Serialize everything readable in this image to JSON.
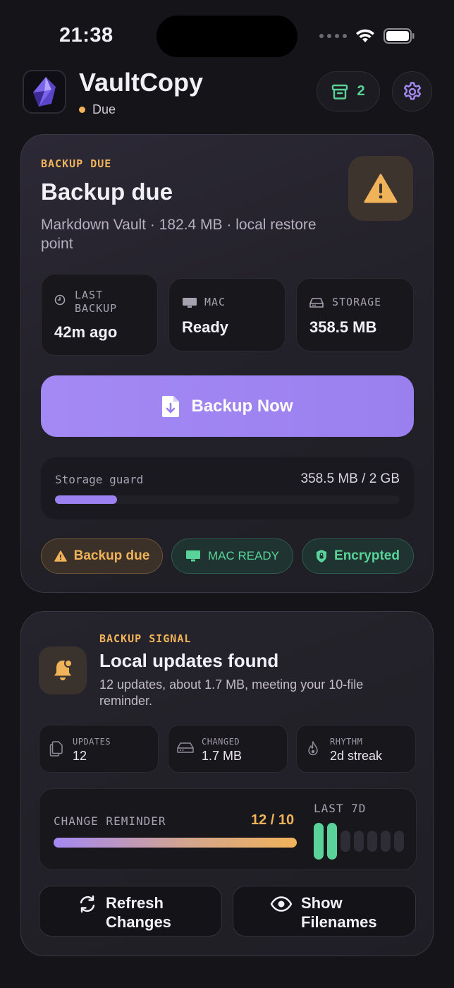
{
  "status_bar": {
    "time": "21:38"
  },
  "header": {
    "app_name": "VaultCopy",
    "status": "Due",
    "archive_count": "2",
    "icons": [
      "app-logo-icon",
      "archive-icon",
      "gear-icon"
    ]
  },
  "backup_card": {
    "eyebrow": "BACKUP DUE",
    "title": "Backup due",
    "subtitle": "Markdown Vault · 182.4 MB · local restore point",
    "stats": [
      {
        "label": "LAST BACKUP",
        "value": "42m ago",
        "icon": "clock-icon"
      },
      {
        "label": "MAC",
        "value": "Ready",
        "icon": "monitor-icon"
      },
      {
        "label": "STORAGE",
        "value": "358.5 MB",
        "icon": "drive-icon"
      }
    ],
    "primary_button": "Backup Now",
    "storage_guard": {
      "label": "Storage guard",
      "value": "358.5 MB / 2 GB",
      "fraction": 0.18
    },
    "chips": [
      {
        "label": "Backup due",
        "icon": "warning-icon"
      },
      {
        "label": "MAC READY",
        "icon": "monitor-icon"
      },
      {
        "label": "Encrypted",
        "icon": "shield-lock-icon"
      }
    ],
    "accent_colors": {
      "amber": "#f1b35a",
      "green": "#5ad39a",
      "purple": "#a489f4"
    }
  },
  "signal_card": {
    "eyebrow": "BACKUP SIGNAL",
    "title": "Local updates found",
    "subtitle": "12 updates, about 1.7 MB, meeting your 10-file reminder.",
    "mini_stats": [
      {
        "label": "UPDATES",
        "value": "12",
        "icon": "files-icon"
      },
      {
        "label": "CHANGED",
        "value": "1.7 MB",
        "icon": "drive-icon"
      },
      {
        "label": "RHYTHM",
        "value": "2d streak",
        "icon": "flame-icon"
      }
    ],
    "reminder": {
      "label": "CHANGE REMINDER",
      "value": "12 / 10",
      "fraction": 1.0,
      "last7_label": "LAST 7D",
      "last7_active": [
        true,
        true,
        false,
        false,
        false,
        false,
        false
      ]
    },
    "buttons": [
      {
        "label": "Refresh Changes",
        "icon": "refresh-icon"
      },
      {
        "label": "Show Filenames",
        "icon": "eye-icon"
      }
    ]
  }
}
